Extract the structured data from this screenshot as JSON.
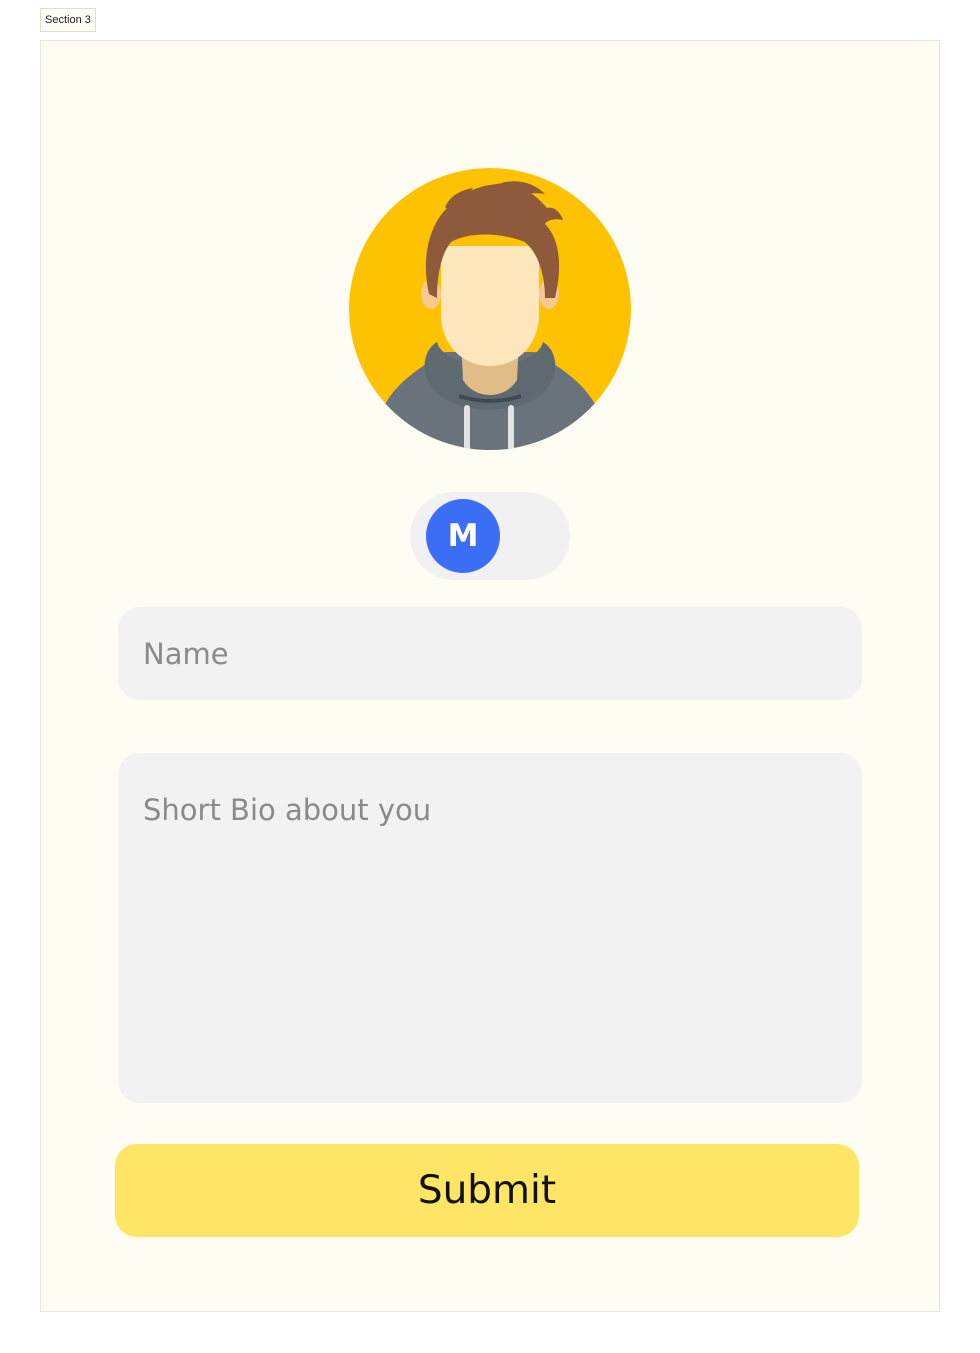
{
  "section": {
    "label": "Section 3"
  },
  "profile": {
    "avatar_icon": "user-avatar-icon",
    "avatar_bg_color": "#fec200"
  },
  "toggle": {
    "knob_label": "M",
    "knob_color": "#3b6ef5",
    "state": "off"
  },
  "form": {
    "name_placeholder": "Name",
    "bio_placeholder": "Short Bio about you",
    "submit_label": "Submit",
    "submit_color": "#fee566"
  }
}
